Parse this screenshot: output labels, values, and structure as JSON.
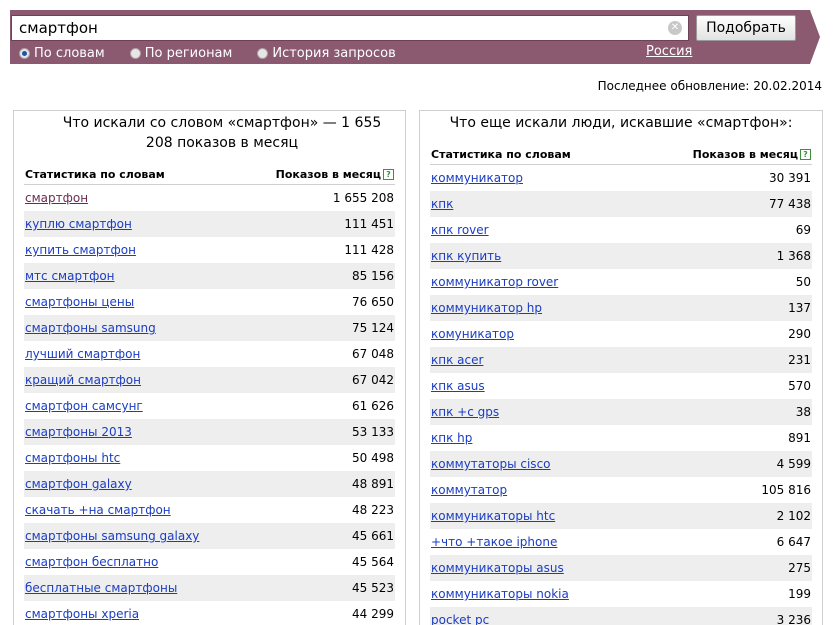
{
  "search": {
    "query": "смартфон",
    "clear": "✕",
    "submit_label": "Подобрать",
    "modes": [
      {
        "label": "По словам",
        "checked": true
      },
      {
        "label": "По регионам",
        "checked": false
      },
      {
        "label": "История запросов",
        "checked": false
      }
    ],
    "region": "Россия"
  },
  "update": "Последнее обновление: 20.02.2014",
  "left": {
    "title": "Что искали со словом «смартфон» — 1 655 208 показов в месяц",
    "col_words": "Статистика по словам",
    "col_count": "Показов в месяц",
    "help": "?",
    "rows": [
      {
        "phrase": "смартфон",
        "count": "1 655 208"
      },
      {
        "phrase": "куплю смартфон",
        "count": "111 451"
      },
      {
        "phrase": "купить смартфон",
        "count": "111 428"
      },
      {
        "phrase": "мтс смартфон",
        "count": "85 156"
      },
      {
        "phrase": "смартфоны цены",
        "count": "76 650"
      },
      {
        "phrase": "смартфоны samsung",
        "count": "75 124"
      },
      {
        "phrase": "лучший смартфон",
        "count": "67 048"
      },
      {
        "phrase": "кращий смартфон",
        "count": "67 042"
      },
      {
        "phrase": "смартфон самсунг",
        "count": "61 626"
      },
      {
        "phrase": "смартфоны 2013",
        "count": "53 133"
      },
      {
        "phrase": "смартфоны htc",
        "count": "50 498"
      },
      {
        "phrase": "смартфон galaxy",
        "count": "48 891"
      },
      {
        "phrase": "скачать +на смартфон",
        "count": "48 223"
      },
      {
        "phrase": "смартфоны samsung galaxy",
        "count": "45 661"
      },
      {
        "phrase": "смартфон бесплатно",
        "count": "45 564"
      },
      {
        "phrase": "бесплатные смартфоны",
        "count": "45 523"
      },
      {
        "phrase": "смартфоны xperia",
        "count": "44 299"
      }
    ]
  },
  "right": {
    "title": "Что еще искали люди, искавшие «смартфон»:",
    "col_words": "Статистика по словам",
    "col_count": "Показов в месяц",
    "help": "?",
    "rows": [
      {
        "phrase": "коммуникатор",
        "count": "30 391"
      },
      {
        "phrase": "кпк",
        "count": "77 438"
      },
      {
        "phrase": "кпк rover",
        "count": "69"
      },
      {
        "phrase": "кпк купить",
        "count": "1 368"
      },
      {
        "phrase": "коммуникатор rover",
        "count": "50"
      },
      {
        "phrase": "коммуникатор hp",
        "count": "137"
      },
      {
        "phrase": "комуникатор",
        "count": "290"
      },
      {
        "phrase": "кпк acer",
        "count": "231"
      },
      {
        "phrase": "кпк asus",
        "count": "570"
      },
      {
        "phrase": "кпк +с gps",
        "count": "38"
      },
      {
        "phrase": "кпк hp",
        "count": "891"
      },
      {
        "phrase": "коммутаторы cisco",
        "count": "4 599"
      },
      {
        "phrase": "коммутатор",
        "count": "105 816"
      },
      {
        "phrase": "коммуникаторы htc",
        "count": "2 102"
      },
      {
        "phrase": "+что +такое iphone",
        "count": "6 647"
      },
      {
        "phrase": "коммуникаторы asus",
        "count": "275"
      },
      {
        "phrase": "коммуникаторы nokia",
        "count": "199"
      },
      {
        "phrase": "pocket pc",
        "count": "3 236"
      }
    ]
  }
}
